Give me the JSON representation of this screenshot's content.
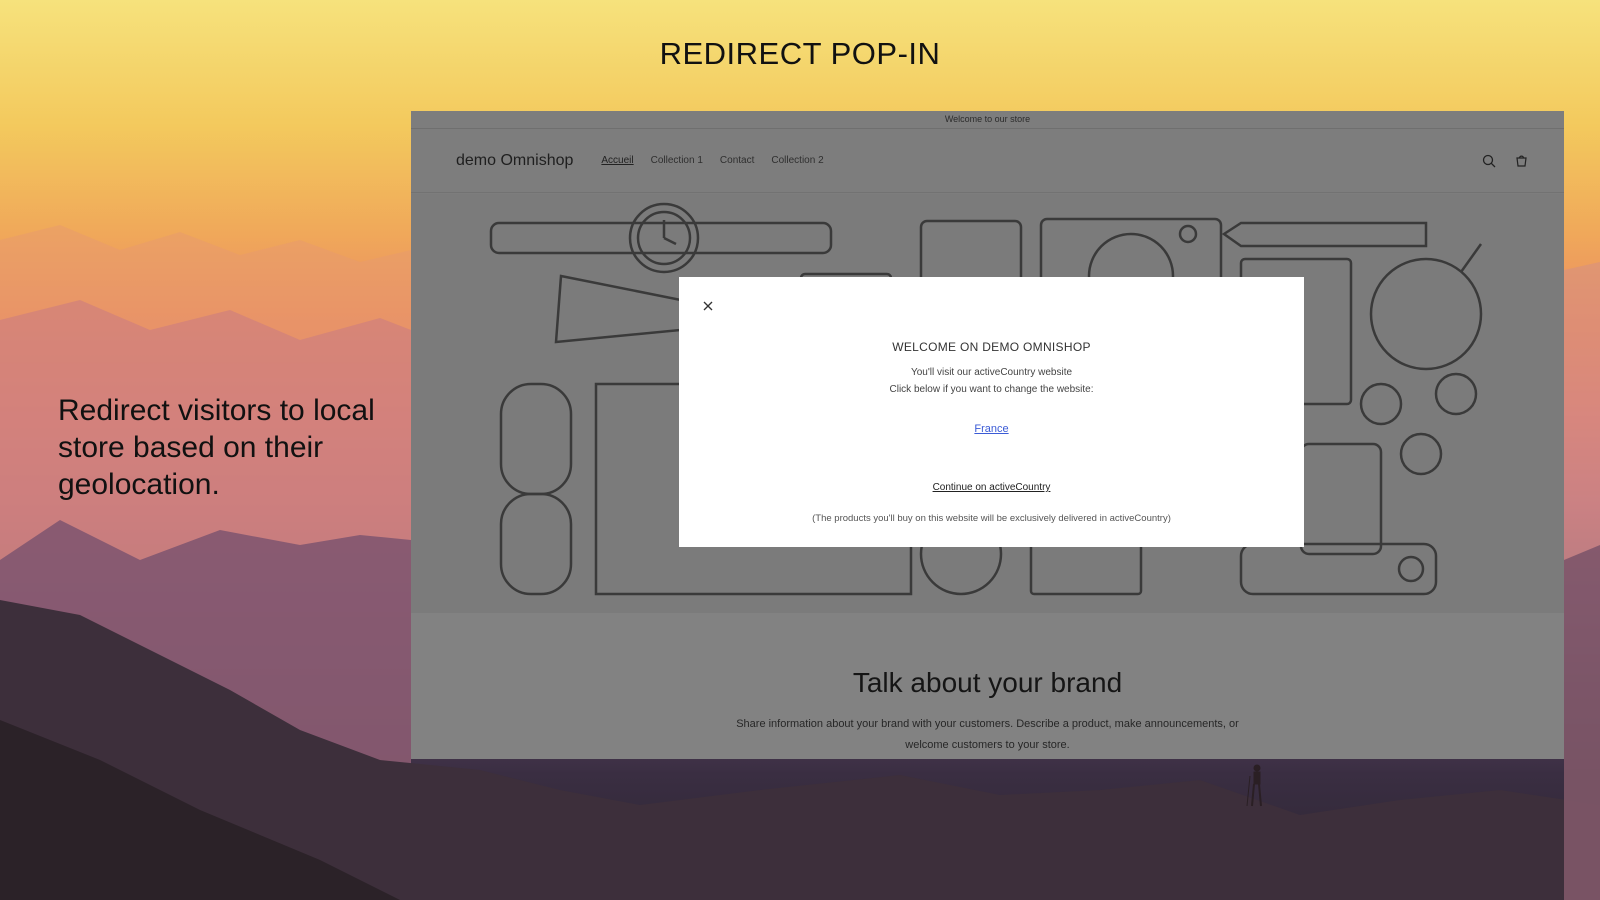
{
  "slide": {
    "title": "REDIRECT POP-IN",
    "caption": "Redirect visitors to local store based on their geolocation."
  },
  "store": {
    "announcement": "Welcome to our store",
    "logo": "demo Omnishop",
    "nav": [
      {
        "label": "Accueil",
        "active": true
      },
      {
        "label": "Collection 1",
        "active": false
      },
      {
        "label": "Contact",
        "active": false
      },
      {
        "label": "Collection 2",
        "active": false
      }
    ],
    "icons": [
      "search-icon",
      "cart-icon"
    ],
    "brand_title": "Talk about your brand",
    "brand_text": "Share information about your brand with your customers. Describe a product, make announcements, or welcome customers to your store."
  },
  "popup": {
    "title": "WELCOME ON DEMO OMNISHOP",
    "line1": "You'll visit our activeCountry website",
    "line2": "Click below if you want to change the website:",
    "country_link": "France",
    "continue_link": "Continue on activeCountry",
    "note": "(The products you'll buy on this website will be exclusively delivered in activeCountry)",
    "close_icon": "close-icon"
  },
  "colors": {
    "overlay": "#7d7d7d",
    "modal_bg": "#ffffff",
    "link": "#3b5bd6"
  }
}
